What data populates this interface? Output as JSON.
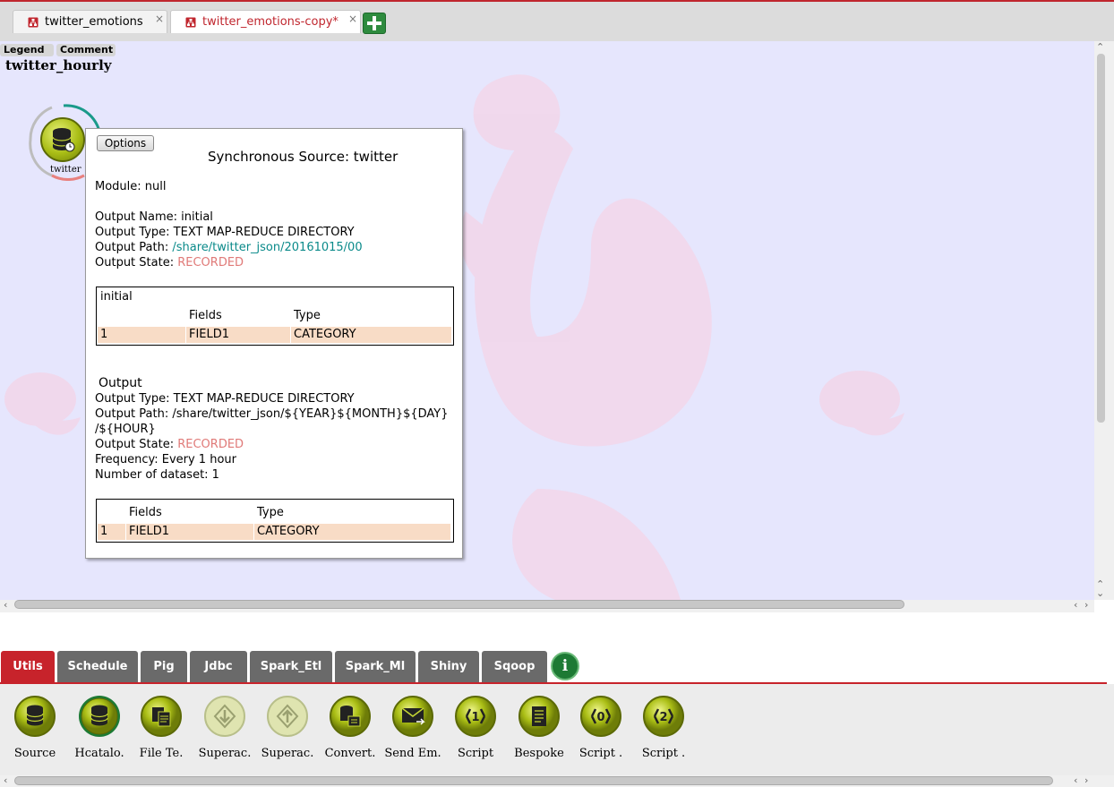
{
  "tabs": [
    {
      "label": "twitter_emotions",
      "close": "×"
    },
    {
      "label": "twitter_emotions-copy*",
      "close": "×"
    }
  ],
  "canvas": {
    "legend_button": "Legend",
    "comment_button": "Comment",
    "workflow_name": "twitter_hourly",
    "node_label": "twitter"
  },
  "popup": {
    "options_button": "Options",
    "title": "Synchronous Source: twitter",
    "module": "Module: null",
    "output_name": "Output Name: initial",
    "output_type": "Output Type: TEXT MAP-REDUCE DIRECTORY",
    "output_path_label": "Output Path:",
    "output_path_value": "/share/twitter_json/20161015/00",
    "output_state_label": "Output State:",
    "output_state_value": "RECORDED",
    "table1": {
      "caption": "initial",
      "headers": [
        "Fields",
        "Type"
      ],
      "rows": [
        [
          "1",
          "FIELD1",
          "CATEGORY"
        ]
      ]
    },
    "output_section": {
      "heading": "Output",
      "output_type": "Output Type: TEXT MAP-REDUCE DIRECTORY",
      "output_path_line1": "Output Path: /share/twitter_json/${YEAR}${MONTH}${DAY}",
      "output_path_line2": "/${HOUR}",
      "output_state_label": "Output State:",
      "output_state_value": "RECORDED",
      "frequency": "Frequency: Every 1 hour",
      "num_datasets": "Number of dataset: 1"
    },
    "table2": {
      "headers": [
        "Fields",
        "Type"
      ],
      "rows": [
        [
          "1",
          "FIELD1",
          "CATEGORY"
        ]
      ]
    }
  },
  "palette_tabs": [
    "Utils",
    "Schedule",
    "Pig",
    "Jdbc",
    "Spark_Etl",
    "Spark_Ml",
    "Shiny",
    "Sqoop"
  ],
  "info_label": "i",
  "palette_items": [
    {
      "label": "Source",
      "icon": "database-icon"
    },
    {
      "label": "Hcatalo.",
      "icon": "database-icon"
    },
    {
      "label": "File Te.",
      "icon": "file-text-icon"
    },
    {
      "label": "Superac.",
      "icon": "download-arrow-icon"
    },
    {
      "label": "Superac.",
      "icon": "upload-arrow-icon"
    },
    {
      "label": "Convert.",
      "icon": "convert-icon"
    },
    {
      "label": "Send Em.",
      "icon": "email-icon"
    },
    {
      "label": "Script",
      "icon": "script-1-icon"
    },
    {
      "label": "Bespoke",
      "icon": "document-icon"
    },
    {
      "label": "Script .",
      "icon": "script-0-icon"
    },
    {
      "label": "Script .",
      "icon": "script-2-icon"
    }
  ],
  "colors": {
    "accent_red": "#c0262e",
    "canvas_bg": "#e6e6fd",
    "node_green": "#a9bd15",
    "link_teal": "#0a8a8a",
    "recorded_red": "#e07a78",
    "table_row": "#f8dcc6"
  }
}
